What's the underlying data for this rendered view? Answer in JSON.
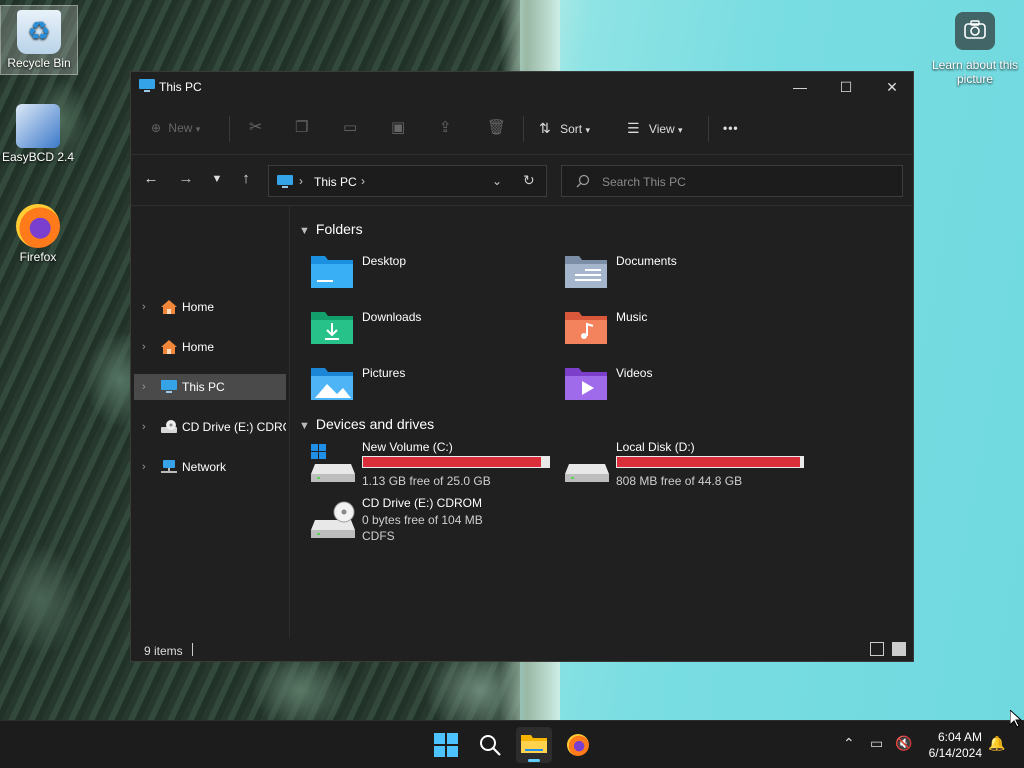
{
  "desktop": {
    "icons": [
      {
        "label": "Recycle Bin"
      },
      {
        "label": "EasyBCD 2.4"
      },
      {
        "label": "Firefox"
      }
    ],
    "spotlight_label": "Learn about this picture"
  },
  "window": {
    "title": "This PC",
    "toolbar": {
      "new_label": "New",
      "sort_label": "Sort",
      "view_label": "View",
      "more_label": "•••"
    },
    "address": {
      "path": "This PC"
    },
    "search": {
      "placeholder": "Search This PC"
    },
    "sidebar": {
      "items": [
        {
          "label": "Home"
        },
        {
          "label": "Home"
        },
        {
          "label": "This PC"
        },
        {
          "label": "CD Drive (E:) CDROM"
        },
        {
          "label": "Network"
        }
      ]
    },
    "folders_heading": "Folders",
    "folders": [
      {
        "label": "Desktop"
      },
      {
        "label": "Documents"
      },
      {
        "label": "Downloads"
      },
      {
        "label": "Music"
      },
      {
        "label": "Pictures"
      },
      {
        "label": "Videos"
      }
    ],
    "drives_heading": "Devices and drives",
    "drives": [
      {
        "name": "New Volume (C:)",
        "info": "1.13 GB free of 25.0 GB",
        "used_fraction": 0.955
      },
      {
        "name": "Local Disk (D:)",
        "info": "808 MB free of 44.8 GB",
        "used_fraction": 0.982
      },
      {
        "name": "CD Drive (E:) CDROM",
        "info": "0 bytes free of 104 MB",
        "fs": "CDFS"
      }
    ],
    "status": {
      "items": "9 items"
    }
  },
  "taskbar": {
    "time": "6:04 AM",
    "date": "6/14/2024"
  },
  "colors": {
    "window_bg": "#202020",
    "drive_bar_fill": "#da2f3b",
    "accent": "#60cdff",
    "selection": "#4a4a4a"
  }
}
